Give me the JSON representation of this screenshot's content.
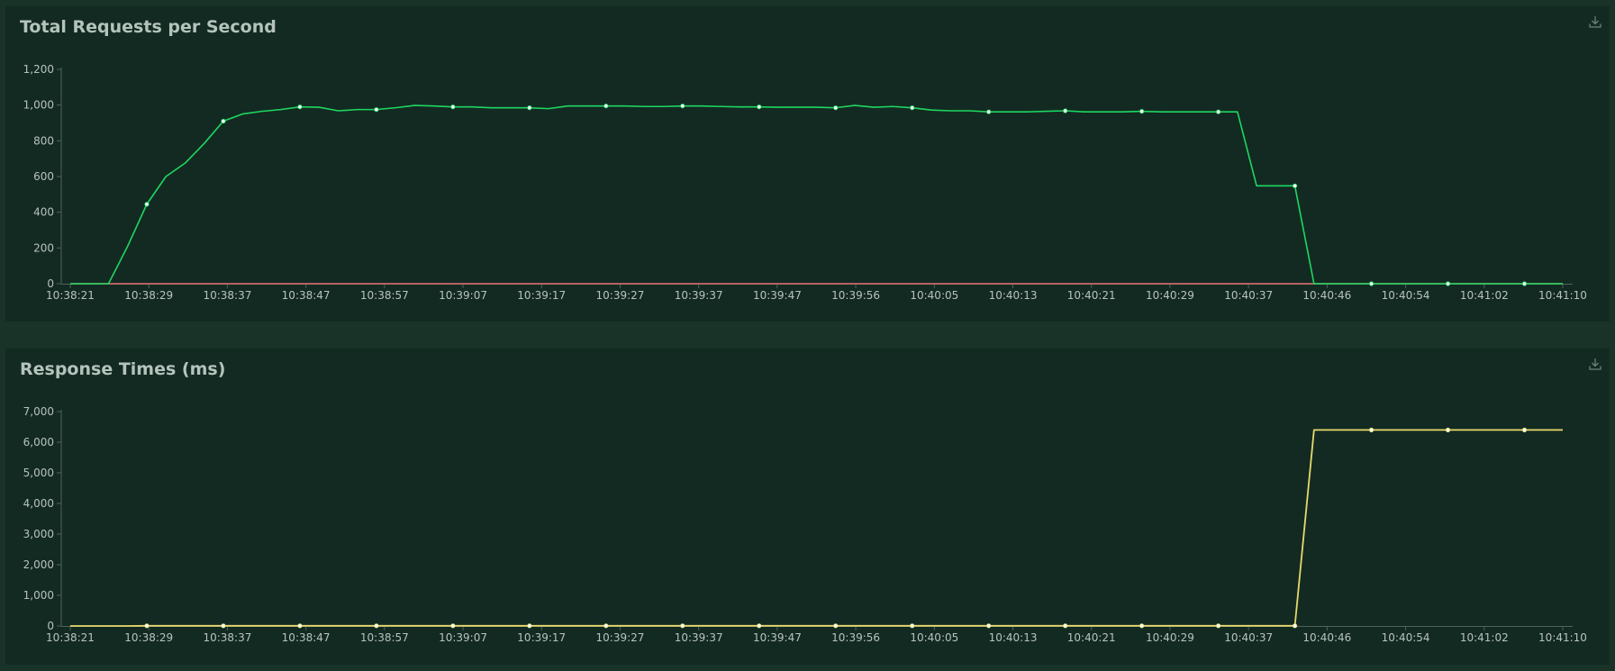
{
  "colors": {
    "page_background": "#193328",
    "panel_background": "#132a22",
    "title_text": "#b4c4bc",
    "tick_text": "#b7c3bd",
    "axis": "#4e625a",
    "rps_series": "#1ed760",
    "failures_series": "#e06c6c",
    "response_series": "#e8d96c",
    "marker": "#ffffff"
  },
  "panels": {
    "rps": {
      "title": "Total Requests per Second",
      "download_icon": "download-icon"
    },
    "response": {
      "title": "Response Times (ms)",
      "download_icon": "download-icon"
    }
  },
  "chart_data": [
    {
      "type": "line",
      "title": "Total Requests per Second",
      "xlabel": "",
      "ylabel": "",
      "ylim": [
        0,
        1200
      ],
      "y_ticks": [
        0,
        200,
        400,
        600,
        800,
        1000,
        1200
      ],
      "y_tick_labels": [
        "0",
        "200",
        "400",
        "600",
        "800",
        "1,000",
        "1,200"
      ],
      "x_ticks": [
        "10:38:21",
        "10:38:29",
        "10:38:37",
        "10:38:47",
        "10:38:57",
        "10:39:07",
        "10:39:17",
        "10:39:27",
        "10:39:37",
        "10:39:47",
        "10:39:56",
        "10:40:05",
        "10:40:13",
        "10:40:21",
        "10:40:29",
        "10:40:37",
        "10:40:46",
        "10:40:54",
        "10:41:02",
        "10:41:10"
      ],
      "grid": false,
      "legend": "none",
      "series": [
        {
          "values": [
            0,
            0,
            0,
            210,
            445,
            600,
            675,
            785,
            910,
            950,
            965,
            975,
            990,
            988,
            968,
            975,
            975,
            985,
            998,
            995,
            990,
            990,
            985,
            985,
            985,
            980,
            995,
            995,
            995,
            995,
            992,
            992,
            995,
            995,
            992,
            990,
            990,
            988,
            988,
            988,
            985,
            998,
            988,
            992,
            985,
            972,
            968,
            968,
            962,
            962,
            962,
            965,
            968,
            962,
            962,
            962,
            965,
            962,
            962,
            962,
            962,
            962,
            548,
            548,
            548,
            0,
            0,
            0,
            0,
            0,
            0,
            0,
            0,
            0,
            0,
            0,
            0,
            0,
            0
          ],
          "markers": [
            4,
            8,
            12,
            16,
            20,
            24,
            28,
            32,
            36,
            40,
            44,
            48,
            52,
            56,
            60,
            64,
            68,
            72,
            76
          ]
        },
        {
          "values": [
            0,
            0,
            0,
            0,
            0,
            0,
            0,
            0,
            0,
            0,
            0,
            0,
            0,
            0,
            0,
            0,
            0,
            0,
            0,
            0,
            0,
            0,
            0,
            0,
            0,
            0,
            0,
            0,
            0,
            0,
            0,
            0,
            0,
            0,
            0,
            0,
            0,
            0,
            0,
            0,
            0,
            0,
            0,
            0,
            0,
            0,
            0,
            0,
            0,
            0,
            0,
            0,
            0,
            0,
            0,
            0,
            0,
            0,
            0,
            0,
            0,
            0,
            0,
            0,
            0,
            0,
            0,
            0,
            0,
            0,
            0,
            0,
            0,
            0,
            0,
            0,
            0,
            0,
            0
          ]
        }
      ]
    },
    {
      "type": "line",
      "title": "Response Times (ms)",
      "xlabel": "",
      "ylabel": "",
      "ylim": [
        0,
        7000
      ],
      "y_ticks": [
        0,
        1000,
        2000,
        3000,
        4000,
        5000,
        6000,
        7000
      ],
      "y_tick_labels": [
        "0",
        "1,000",
        "2,000",
        "3,000",
        "4,000",
        "5,000",
        "6,000",
        "7,000"
      ],
      "x_ticks": [
        "10:38:21",
        "10:38:29",
        "10:38:37",
        "10:38:47",
        "10:38:57",
        "10:39:07",
        "10:39:17",
        "10:39:27",
        "10:39:37",
        "10:39:47",
        "10:39:56",
        "10:40:05",
        "10:40:13",
        "10:40:21",
        "10:40:29",
        "10:40:37",
        "10:40:46",
        "10:40:54",
        "10:41:02",
        "10:41:10"
      ],
      "grid": false,
      "legend": "none",
      "series": [
        {
          "values": [
            0,
            0,
            0,
            0,
            5,
            5,
            5,
            5,
            5,
            5,
            5,
            5,
            5,
            5,
            5,
            5,
            5,
            5,
            5,
            5,
            5,
            5,
            5,
            5,
            5,
            5,
            5,
            5,
            5,
            5,
            5,
            5,
            5,
            5,
            5,
            5,
            5,
            5,
            5,
            5,
            5,
            5,
            5,
            5,
            5,
            5,
            5,
            5,
            5,
            5,
            5,
            5,
            5,
            5,
            5,
            5,
            5,
            5,
            5,
            5,
            5,
            5,
            5,
            5,
            5,
            6400,
            6400,
            6400,
            6400,
            6400,
            6400,
            6400,
            6400,
            6400,
            6400,
            6400,
            6400,
            6400,
            6400
          ],
          "markers": [
            4,
            8,
            12,
            16,
            20,
            24,
            28,
            32,
            36,
            40,
            44,
            48,
            52,
            56,
            60,
            64,
            68,
            72,
            76
          ]
        }
      ]
    }
  ]
}
